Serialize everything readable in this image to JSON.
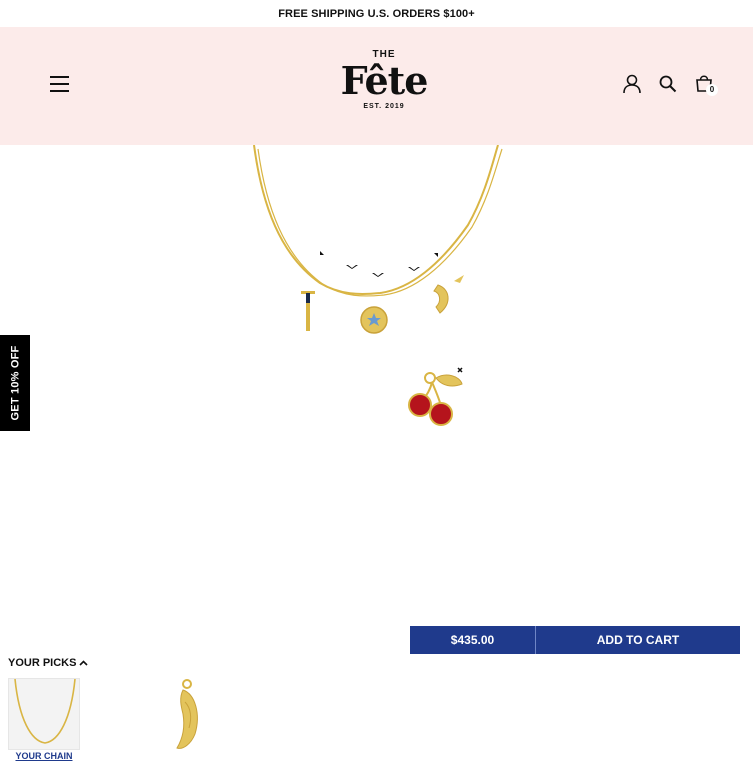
{
  "announcement": {
    "text": "FREE SHIPPING U.S. ORDERS $100+"
  },
  "header": {
    "logo": {
      "the": "THE",
      "name": "Fête",
      "est": "EST. 2019"
    },
    "icons": [
      "menu-icon",
      "account-icon",
      "search-icon",
      "cart-icon"
    ],
    "cart_count": "0",
    "background": "#fcebea"
  },
  "side_tab": {
    "label": "GET 10% OFF"
  },
  "product": {
    "price": "$435.00",
    "add_to_cart": "ADD TO CART",
    "accent": "#1f3a8c"
  },
  "picks": {
    "title": "YOUR PICKS",
    "items": [
      {
        "label": "YOUR CHAIN"
      }
    ]
  }
}
